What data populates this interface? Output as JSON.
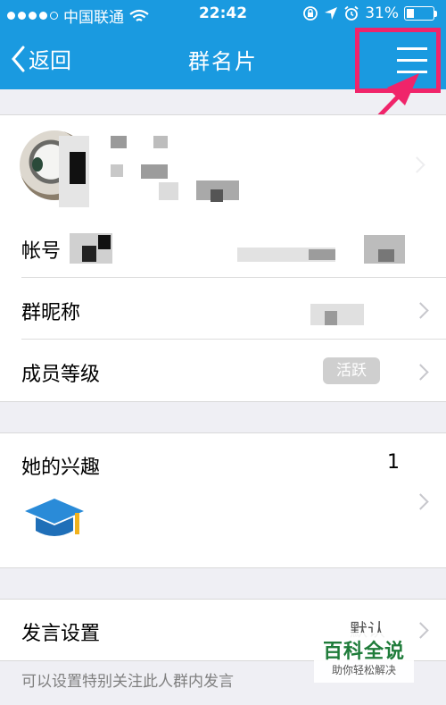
{
  "status_bar": {
    "carrier": "中国联通",
    "time": "22:42",
    "battery_percent": "31%",
    "battery_level": 0.31
  },
  "nav": {
    "back_label": "返回",
    "title": "群名片"
  },
  "rows": {
    "account_label": "帐号",
    "group_nickname_label": "群昵称",
    "member_level_label": "成员等级",
    "member_level_badge": "活跃",
    "interests_label": "她的兴趣",
    "interests_count": "1",
    "speech_settings_label": "发言设置",
    "speech_settings_value": "默认"
  },
  "hint": "可以设置特别关注此人群内发言",
  "watermark": {
    "title": "百科全说",
    "subtitle": "助你轻松解决"
  },
  "colors": {
    "nav_blue": "#1a9ae0",
    "highlight_pink": "#f0246a",
    "badge_gray": "#cfcfcf",
    "cap_blue": "#2a8bd8",
    "cap_yellow": "#f2b21c"
  },
  "icons": [
    "signal-dots",
    "wifi-icon",
    "lock-rotation-icon",
    "location-arrow-icon",
    "alarm-icon",
    "battery-icon",
    "back-chevron-icon",
    "hamburger-menu-icon",
    "chevron-right-icon",
    "graduation-cap-icon"
  ]
}
